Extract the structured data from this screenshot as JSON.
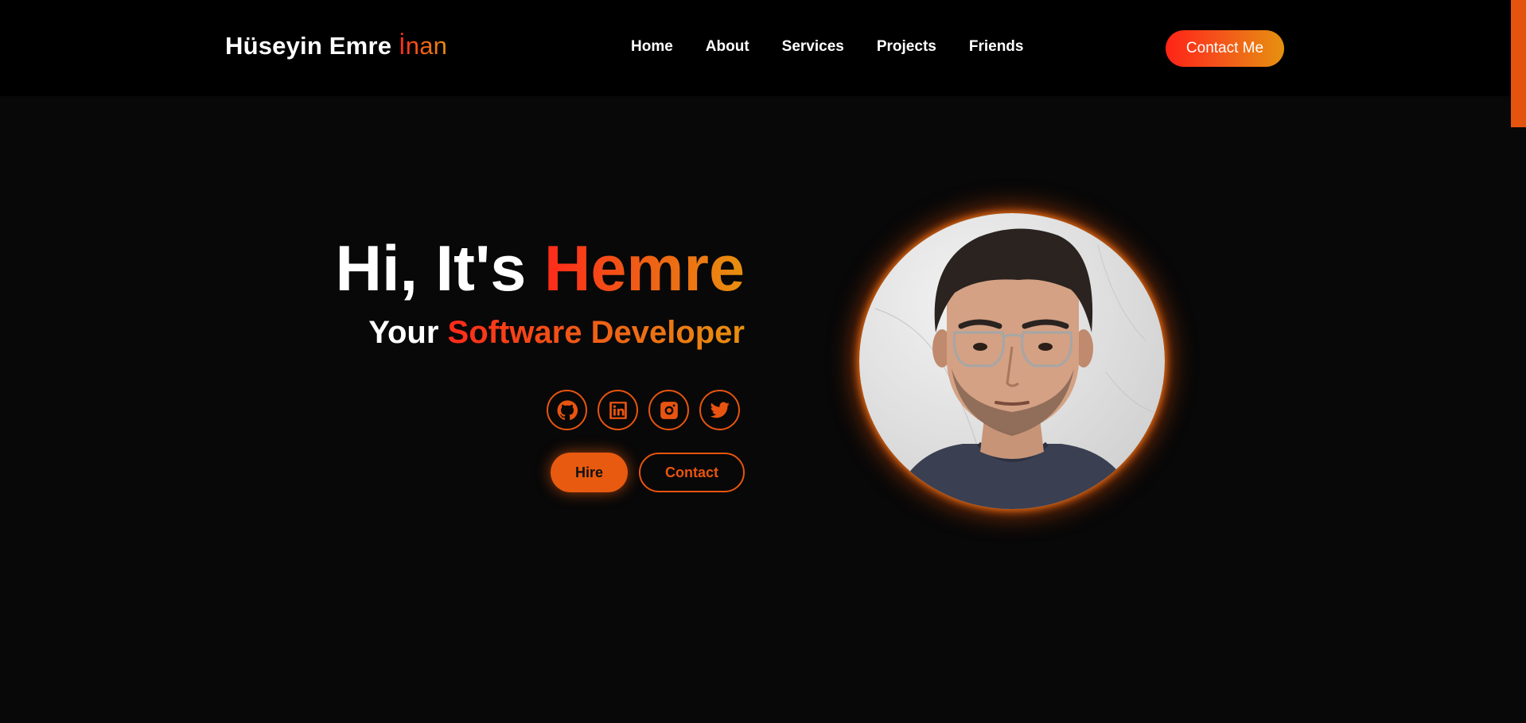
{
  "logo": {
    "first": "Hüseyin Emre ",
    "accent": "İnan"
  },
  "nav": {
    "home": "Home",
    "about": "About",
    "services": "Services",
    "projects": "Projects",
    "friends": "Friends"
  },
  "header_button": "Contact Me",
  "hero": {
    "title_prefix": "Hi, It's ",
    "title_name": "Hemre",
    "subtitle_prefix": "Your ",
    "subtitle_role": "Software Developer"
  },
  "socials": [
    "github-icon",
    "linkedin-icon",
    "instagram-icon",
    "twitter-icon"
  ],
  "buttons": {
    "hire": "Hire",
    "contact": "Contact"
  },
  "colors": {
    "background": "#080808",
    "header": "#000000",
    "accent": "#e8540f",
    "gradient_start": "#ff2a1a",
    "gradient_end": "#e8900f"
  }
}
